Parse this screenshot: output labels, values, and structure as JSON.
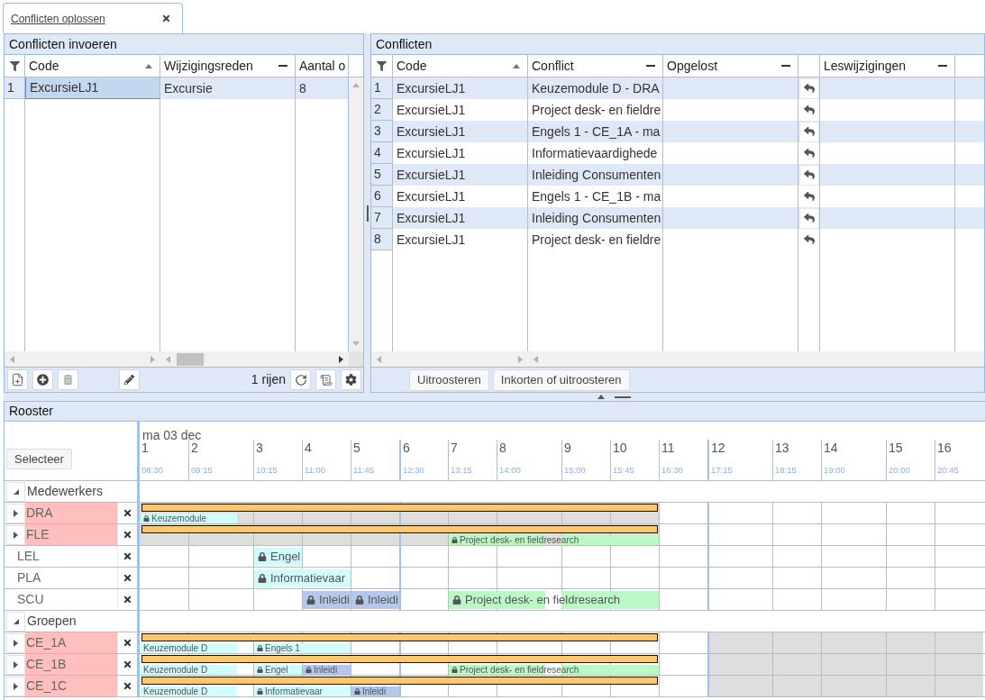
{
  "tabs": [
    {
      "label": "Conflicten oplossen",
      "selected": true
    }
  ],
  "entry_panel": {
    "title": "Conflicten invoeren",
    "columns": [
      {
        "label": "Code",
        "kind": "sorted"
      },
      {
        "label": "Wijzigingsreden",
        "kind": "menu"
      },
      {
        "label": "Aantal o",
        "kind": "plain"
      }
    ],
    "rows": [
      {
        "number": "1",
        "cells": [
          "ExcursieLJ1",
          "Excursie",
          "8"
        ],
        "selected": true
      }
    ],
    "row_count": "1 rijen"
  },
  "conflict_panel": {
    "title": "Conflicten",
    "columns": [
      {
        "label": "Code",
        "kind": "sorted"
      },
      {
        "label": "Conflict",
        "kind": "menu"
      },
      {
        "label": "Opgelost",
        "kind": "menu"
      },
      {
        "label": "Leswijzigingen",
        "kind": "menu"
      }
    ],
    "rows": [
      {
        "number": "1",
        "code": "ExcursieLJ1",
        "conflict": "Keuzemodule D - DRA"
      },
      {
        "number": "2",
        "code": "ExcursieLJ1",
        "conflict": "Project desk- en fieldre"
      },
      {
        "number": "3",
        "code": "ExcursieLJ1",
        "conflict": "Engels 1 - CE_1A - ma"
      },
      {
        "number": "4",
        "code": "ExcursieLJ1",
        "conflict": "Informatievaardighede"
      },
      {
        "number": "5",
        "code": "ExcursieLJ1",
        "conflict": "Inleiding Consumenten"
      },
      {
        "number": "6",
        "code": "ExcursieLJ1",
        "conflict": "Engels 1 - CE_1B - ma"
      },
      {
        "number": "7",
        "code": "ExcursieLJ1",
        "conflict": "Inleiding Consumenten"
      },
      {
        "number": "8",
        "code": "ExcursieLJ1",
        "conflict": "Project desk- en fieldre"
      }
    ],
    "buttons": [
      "Uitroosteren",
      "Inkorten of uitroosteren"
    ]
  },
  "rooster": {
    "title": "Rooster",
    "select_button": "Selecteer",
    "date": "ma 03 dec",
    "slots": [
      {
        "number": "1",
        "time": "08:30",
        "divider": true
      },
      {
        "number": "2",
        "time": "09:15",
        "divider": false
      },
      {
        "number": "3",
        "time": "10:15",
        "divider": false
      },
      {
        "number": "4",
        "time": "11:00",
        "divider": false
      },
      {
        "number": "5",
        "time": "11:45",
        "divider": false
      },
      {
        "number": "6",
        "time": "12:30",
        "divider": true
      },
      {
        "number": "7",
        "time": "13:15",
        "divider": false
      },
      {
        "number": "8",
        "time": "14:00",
        "divider": false
      },
      {
        "number": "9",
        "time": "15:00",
        "divider": false
      },
      {
        "number": "10",
        "time": "15:45",
        "divider": false
      },
      {
        "number": "11",
        "time": "16:30",
        "divider": false
      },
      {
        "number": "12",
        "time": "17:15",
        "divider": true
      },
      {
        "number": "13",
        "time": "18:15",
        "divider": false
      },
      {
        "number": "14",
        "time": "19:00",
        "divider": false
      },
      {
        "number": "15",
        "time": "20:00",
        "divider": false
      },
      {
        "number": "16",
        "time": "20:45",
        "divider": false
      }
    ],
    "sections": [
      {
        "title": "Medewerkers",
        "expanded": true,
        "rows": [
          {
            "name": "DRA",
            "conflict": true,
            "expanded": false,
            "shading": [
              {
                "kind": "blocked"
              },
              {
                "kind": "blocked"
              },
              {
                "kind": "blocked"
              },
              {
                "kind": "blocked"
              },
              {
                "kind": "blocked"
              },
              {
                "kind": "blocked"
              },
              {
                "kind": "blocked"
              },
              {
                "kind": "blocked"
              },
              {
                "kind": "blocked"
              },
              {
                "kind": "blocked"
              },
              {
                "kind": "open"
              },
              {
                "kind": "open"
              },
              {
                "kind": "open"
              },
              {
                "kind": "open"
              },
              {
                "kind": "open"
              },
              {
                "kind": "open"
              }
            ],
            "bar": [
              {
                "kind": "bar"
              },
              {
                "kind": "bar"
              },
              {
                "kind": "bar"
              },
              {
                "kind": "bar"
              },
              {
                "kind": "bar"
              },
              {
                "kind": "bar"
              },
              {
                "kind": "bar"
              },
              {
                "kind": "bar"
              },
              {
                "kind": "bar"
              },
              {
                "kind": "bar"
              },
              {
                "kind": "none"
              },
              {
                "kind": "none"
              },
              {
                "kind": "none"
              },
              {
                "kind": "none"
              },
              {
                "kind": "none"
              },
              {
                "kind": "none"
              }
            ],
            "lessons": [
              {
                "kind": "start",
                "label": "Keuzemodule",
                "color": "#d2fbfb",
                "locked": true
              },
              {
                "kind": "more"
              },
              {
                "kind": "none"
              },
              {
                "kind": "none"
              },
              {
                "kind": "none"
              },
              {
                "kind": "none"
              },
              {
                "kind": "none"
              },
              {
                "kind": "none"
              },
              {
                "kind": "none"
              },
              {
                "kind": "none"
              },
              {
                "kind": "none"
              },
              {
                "kind": "none"
              },
              {
                "kind": "none"
              },
              {
                "kind": "none"
              },
              {
                "kind": "none"
              },
              {
                "kind": "none"
              }
            ]
          },
          {
            "name": "FLE",
            "conflict": true,
            "expanded": false,
            "shading": [
              {
                "kind": "blocked"
              },
              {
                "kind": "blocked"
              },
              {
                "kind": "blocked"
              },
              {
                "kind": "blocked"
              },
              {
                "kind": "blocked"
              },
              {
                "kind": "blocked"
              },
              {
                "kind": "blocked"
              },
              {
                "kind": "blocked"
              },
              {
                "kind": "blocked"
              },
              {
                "kind": "blocked"
              },
              {
                "kind": "open"
              },
              {
                "kind": "open"
              },
              {
                "kind": "open"
              },
              {
                "kind": "open"
              },
              {
                "kind": "open"
              },
              {
                "kind": "open"
              }
            ],
            "bar": [
              {
                "kind": "bar"
              },
              {
                "kind": "bar"
              },
              {
                "kind": "bar"
              },
              {
                "kind": "bar"
              },
              {
                "kind": "bar"
              },
              {
                "kind": "bar"
              },
              {
                "kind": "bar"
              },
              {
                "kind": "bar"
              },
              {
                "kind": "bar"
              },
              {
                "kind": "bar"
              },
              {
                "kind": "none"
              },
              {
                "kind": "none"
              },
              {
                "kind": "none"
              },
              {
                "kind": "none"
              },
              {
                "kind": "none"
              },
              {
                "kind": "none"
              }
            ],
            "lessons": [
              {
                "kind": "none"
              },
              {
                "kind": "none"
              },
              {
                "kind": "none"
              },
              {
                "kind": "none"
              },
              {
                "kind": "none"
              },
              {
                "kind": "none"
              },
              {
                "kind": "start",
                "label": "Project desk- en fieldresearch",
                "color": "#bcf7c6",
                "locked": true
              },
              {
                "kind": "more"
              },
              {
                "kind": "more"
              },
              {
                "kind": "more"
              },
              {
                "kind": "none"
              },
              {
                "kind": "none"
              },
              {
                "kind": "none"
              },
              {
                "kind": "none"
              },
              {
                "kind": "none"
              },
              {
                "kind": "none"
              }
            ]
          },
          {
            "name": "LEL",
            "conflict": false,
            "lessons": [
              {
                "kind": "none"
              },
              {
                "kind": "none"
              },
              {
                "kind": "start",
                "label": "Engel",
                "color": "#d2fbfb",
                "locked": true
              },
              {
                "kind": "none"
              },
              {
                "kind": "none"
              },
              {
                "kind": "none"
              },
              {
                "kind": "none"
              },
              {
                "kind": "none"
              },
              {
                "kind": "none"
              },
              {
                "kind": "none"
              },
              {
                "kind": "none"
              },
              {
                "kind": "none"
              },
              {
                "kind": "none"
              },
              {
                "kind": "none"
              },
              {
                "kind": "none"
              },
              {
                "kind": "none"
              }
            ]
          },
          {
            "name": "PLA",
            "conflict": false,
            "lessons": [
              {
                "kind": "none"
              },
              {
                "kind": "none"
              },
              {
                "kind": "start",
                "label": "Informatievaar",
                "color": "#d2fbfb",
                "locked": true
              },
              {
                "kind": "more"
              },
              {
                "kind": "none"
              },
              {
                "kind": "none"
              },
              {
                "kind": "none"
              },
              {
                "kind": "none"
              },
              {
                "kind": "none"
              },
              {
                "kind": "none"
              },
              {
                "kind": "none"
              },
              {
                "kind": "none"
              },
              {
                "kind": "none"
              },
              {
                "kind": "none"
              },
              {
                "kind": "none"
              },
              {
                "kind": "none"
              }
            ]
          },
          {
            "name": "SCU",
            "conflict": false,
            "lessons": [
              {
                "kind": "none"
              },
              {
                "kind": "none"
              },
              {
                "kind": "none"
              },
              {
                "kind": "start",
                "label": "Inleidi",
                "color": "#b6c8ea",
                "locked": true
              },
              {
                "kind": "start",
                "label": "Inleidi",
                "color": "#b6c8ea",
                "locked": true
              },
              {
                "kind": "none"
              },
              {
                "kind": "start",
                "label": "Project desk- en fieldresearch",
                "color": "#bcf7c6",
                "locked": true
              },
              {
                "kind": "more"
              },
              {
                "kind": "more"
              },
              {
                "kind": "more"
              },
              {
                "kind": "none"
              },
              {
                "kind": "none"
              },
              {
                "kind": "none"
              },
              {
                "kind": "none"
              },
              {
                "kind": "none"
              },
              {
                "kind": "none"
              }
            ]
          }
        ]
      },
      {
        "title": "Groepen",
        "expanded": true,
        "rows": [
          {
            "name": "CE_1A",
            "conflict": true,
            "expanded": false,
            "shading": [
              {
                "kind": "open"
              },
              {
                "kind": "open"
              },
              {
                "kind": "open"
              },
              {
                "kind": "open"
              },
              {
                "kind": "open"
              },
              {
                "kind": "open"
              },
              {
                "kind": "open"
              },
              {
                "kind": "open"
              },
              {
                "kind": "open"
              },
              {
                "kind": "open"
              },
              {
                "kind": "open"
              },
              {
                "kind": "blocked"
              },
              {
                "kind": "blocked"
              },
              {
                "kind": "blocked"
              },
              {
                "kind": "blocked"
              },
              {
                "kind": "blocked"
              }
            ],
            "bar": [
              {
                "kind": "bar"
              },
              {
                "kind": "bar"
              },
              {
                "kind": "bar"
              },
              {
                "kind": "bar"
              },
              {
                "kind": "bar"
              },
              {
                "kind": "bar"
              },
              {
                "kind": "bar"
              },
              {
                "kind": "bar"
              },
              {
                "kind": "bar"
              },
              {
                "kind": "bar"
              },
              {
                "kind": "none"
              },
              {
                "kind": "none"
              },
              {
                "kind": "none"
              },
              {
                "kind": "none"
              },
              {
                "kind": "none"
              },
              {
                "kind": "none"
              }
            ],
            "lessons": [
              {
                "kind": "start",
                "label": "Keuzemodule D",
                "color": "#d2fbfb",
                "locked": false
              },
              {
                "kind": "more"
              },
              {
                "kind": "start",
                "label": "Engels 1",
                "color": "#d2fbfb",
                "locked": true
              },
              {
                "kind": "more"
              },
              {
                "kind": "none"
              },
              {
                "kind": "none"
              },
              {
                "kind": "none"
              },
              {
                "kind": "none"
              },
              {
                "kind": "none"
              },
              {
                "kind": "none"
              },
              {
                "kind": "none"
              },
              {
                "kind": "none"
              },
              {
                "kind": "none"
              },
              {
                "kind": "none"
              },
              {
                "kind": "none"
              },
              {
                "kind": "none"
              }
            ]
          },
          {
            "name": "CE_1B",
            "conflict": true,
            "expanded": false,
            "shading": [
              {
                "kind": "open"
              },
              {
                "kind": "open"
              },
              {
                "kind": "open"
              },
              {
                "kind": "open"
              },
              {
                "kind": "open"
              },
              {
                "kind": "open"
              },
              {
                "kind": "open"
              },
              {
                "kind": "open"
              },
              {
                "kind": "open"
              },
              {
                "kind": "open"
              },
              {
                "kind": "open"
              },
              {
                "kind": "blocked"
              },
              {
                "kind": "blocked"
              },
              {
                "kind": "blocked"
              },
              {
                "kind": "blocked"
              },
              {
                "kind": "blocked"
              }
            ],
            "bar": [
              {
                "kind": "bar"
              },
              {
                "kind": "bar"
              },
              {
                "kind": "bar"
              },
              {
                "kind": "bar"
              },
              {
                "kind": "bar"
              },
              {
                "kind": "bar"
              },
              {
                "kind": "bar"
              },
              {
                "kind": "bar"
              },
              {
                "kind": "bar"
              },
              {
                "kind": "bar"
              },
              {
                "kind": "none"
              },
              {
                "kind": "none"
              },
              {
                "kind": "none"
              },
              {
                "kind": "none"
              },
              {
                "kind": "none"
              },
              {
                "kind": "none"
              }
            ],
            "lessons": [
              {
                "kind": "start",
                "label": "Keuzemodule D",
                "color": "#d2fbfb",
                "locked": false
              },
              {
                "kind": "more"
              },
              {
                "kind": "start",
                "label": "Engel",
                "color": "#d2fbfb",
                "locked": true
              },
              {
                "kind": "start",
                "label": "Inleidi",
                "color": "#b6c8ea",
                "locked": true
              },
              {
                "kind": "none"
              },
              {
                "kind": "none"
              },
              {
                "kind": "start",
                "label": "Project desk- en fieldresearch",
                "color": "#bcf7c6",
                "locked": true
              },
              {
                "kind": "more"
              },
              {
                "kind": "more"
              },
              {
                "kind": "more"
              },
              {
                "kind": "none"
              },
              {
                "kind": "none"
              },
              {
                "kind": "none"
              },
              {
                "kind": "none"
              },
              {
                "kind": "none"
              },
              {
                "kind": "none"
              }
            ]
          },
          {
            "name": "CE_1C",
            "conflict": true,
            "expanded": false,
            "shading": [
              {
                "kind": "open"
              },
              {
                "kind": "open"
              },
              {
                "kind": "open"
              },
              {
                "kind": "open"
              },
              {
                "kind": "open"
              },
              {
                "kind": "open"
              },
              {
                "kind": "open"
              },
              {
                "kind": "open"
              },
              {
                "kind": "open"
              },
              {
                "kind": "open"
              },
              {
                "kind": "open"
              },
              {
                "kind": "blocked"
              },
              {
                "kind": "blocked"
              },
              {
                "kind": "blocked"
              },
              {
                "kind": "blocked"
              },
              {
                "kind": "blocked"
              }
            ],
            "bar": [
              {
                "kind": "bar"
              },
              {
                "kind": "bar"
              },
              {
                "kind": "bar"
              },
              {
                "kind": "bar"
              },
              {
                "kind": "bar"
              },
              {
                "kind": "bar"
              },
              {
                "kind": "bar"
              },
              {
                "kind": "bar"
              },
              {
                "kind": "bar"
              },
              {
                "kind": "bar"
              },
              {
                "kind": "none"
              },
              {
                "kind": "none"
              },
              {
                "kind": "none"
              },
              {
                "kind": "none"
              },
              {
                "kind": "none"
              },
              {
                "kind": "none"
              }
            ],
            "lessons": [
              {
                "kind": "start",
                "label": "Keuzemodule D",
                "color": "#d2fbfb",
                "locked": false
              },
              {
                "kind": "more"
              },
              {
                "kind": "start",
                "label": "Informatievaar",
                "color": "#d2fbfb",
                "locked": true
              },
              {
                "kind": "more"
              },
              {
                "kind": "start",
                "label": "Inleidi",
                "color": "#b6c8ea",
                "locked": true
              },
              {
                "kind": "none"
              },
              {
                "kind": "none"
              },
              {
                "kind": "none"
              },
              {
                "kind": "none"
              },
              {
                "kind": "none"
              },
              {
                "kind": "none"
              },
              {
                "kind": "none"
              },
              {
                "kind": "none"
              },
              {
                "kind": "none"
              },
              {
                "kind": "none"
              },
              {
                "kind": "none"
              }
            ]
          }
        ]
      }
    ]
  }
}
